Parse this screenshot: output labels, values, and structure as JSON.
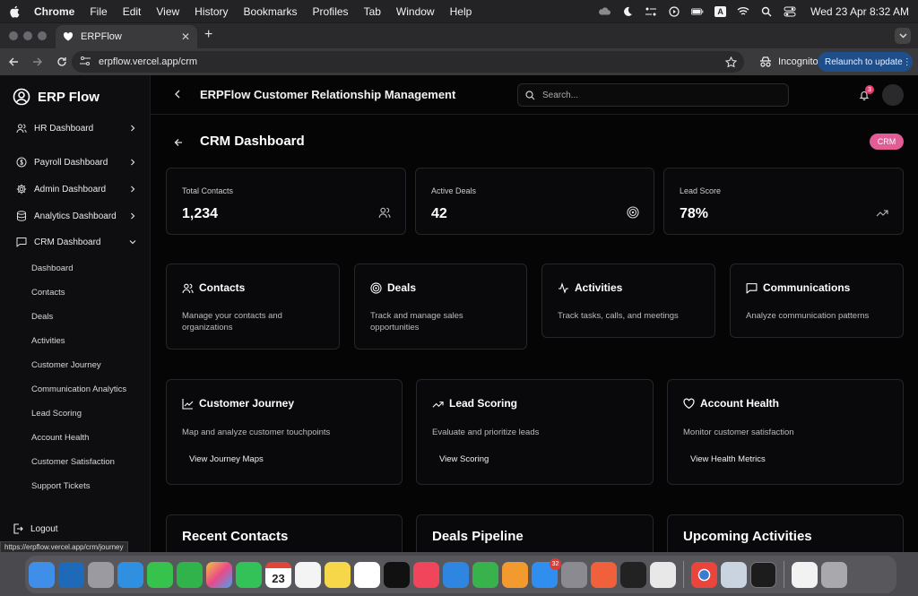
{
  "menubar": {
    "app": "Chrome",
    "items": [
      "File",
      "Edit",
      "View",
      "History",
      "Bookmarks",
      "Profiles",
      "Tab",
      "Window",
      "Help"
    ],
    "input_source": "A",
    "clock": "Wed 23 Apr  8:32 AM"
  },
  "browser": {
    "tab_title": "ERPFlow",
    "url": "erpflow.vercel.app/crm",
    "incognito_label": "Incognito",
    "relaunch_label": "Relaunch to update",
    "status_url": "https://erpflow.vercel.app/crm/journey"
  },
  "sidebar": {
    "brand": "ERP Flow",
    "nav": [
      {
        "label": "HR Dashboard",
        "icon": "users-icon"
      },
      {
        "label": "Payroll Dashboard",
        "icon": "dollar-icon"
      },
      {
        "label": "Admin Dashboard",
        "icon": "gear-icon"
      },
      {
        "label": "Analytics Dashboard",
        "icon": "database-icon"
      },
      {
        "label": "CRM Dashboard",
        "icon": "chat-icon"
      }
    ],
    "crm_sub": [
      "Dashboard",
      "Contacts",
      "Deals",
      "Activities",
      "Customer Journey",
      "Communication Analytics",
      "Lead Scoring",
      "Account Health",
      "Customer Satisfaction",
      "Support Tickets"
    ],
    "logout": "Logout"
  },
  "header": {
    "title": "ERPFlow Customer Relationship Management",
    "search_placeholder": "Search...",
    "notification_count": "3"
  },
  "page": {
    "title": "CRM Dashboard",
    "badge": "CRM"
  },
  "stats": [
    {
      "label": "Total Contacts",
      "value": "1,234",
      "icon": "users-icon"
    },
    {
      "label": "Active Deals",
      "value": "42",
      "icon": "target-icon"
    },
    {
      "label": "Lead Score",
      "value": "78%",
      "icon": "trending-up-icon"
    }
  ],
  "modules": [
    {
      "title": "Contacts",
      "desc": "Manage your contacts and organizations",
      "icon": "users-icon"
    },
    {
      "title": "Deals",
      "desc": "Track and manage sales opportunities",
      "icon": "target-icon"
    },
    {
      "title": "Activities",
      "desc": "Track tasks, calls, and meetings",
      "icon": "activity-icon"
    },
    {
      "title": "Communications",
      "desc": "Analyze communication patterns",
      "icon": "message-icon"
    }
  ],
  "features": [
    {
      "title": "Customer Journey",
      "desc": "Map and analyze customer touchpoints",
      "link": "View Journey Maps",
      "icon": "line-chart-icon"
    },
    {
      "title": "Lead Scoring",
      "desc": "Evaluate and prioritize leads",
      "link": "View Scoring",
      "icon": "trending-up-icon"
    },
    {
      "title": "Account Health",
      "desc": "Monitor customer satisfaction",
      "link": "View Health Metrics",
      "icon": "heart-icon"
    }
  ],
  "bottom_sections": [
    "Recent Contacts",
    "Deals Pipeline",
    "Upcoming Activities"
  ],
  "dock": {
    "calendar_day": "23",
    "appstore_badge": "32"
  }
}
